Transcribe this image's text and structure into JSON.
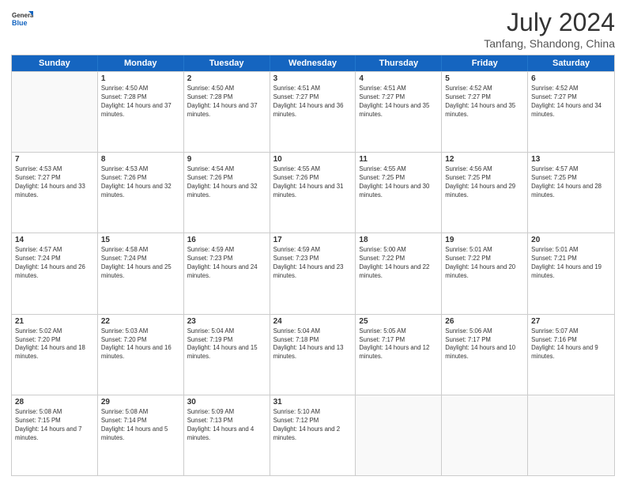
{
  "header": {
    "logo": {
      "general": "General",
      "blue": "Blue"
    },
    "title": "July 2024",
    "location": "Tanfang, Shandong, China"
  },
  "days_of_week": [
    "Sunday",
    "Monday",
    "Tuesday",
    "Wednesday",
    "Thursday",
    "Friday",
    "Saturday"
  ],
  "weeks": [
    [
      {
        "day": "",
        "empty": true
      },
      {
        "day": "1",
        "sunrise": "Sunrise: 4:50 AM",
        "sunset": "Sunset: 7:28 PM",
        "daylight": "Daylight: 14 hours and 37 minutes."
      },
      {
        "day": "2",
        "sunrise": "Sunrise: 4:50 AM",
        "sunset": "Sunset: 7:28 PM",
        "daylight": "Daylight: 14 hours and 37 minutes."
      },
      {
        "day": "3",
        "sunrise": "Sunrise: 4:51 AM",
        "sunset": "Sunset: 7:27 PM",
        "daylight": "Daylight: 14 hours and 36 minutes."
      },
      {
        "day": "4",
        "sunrise": "Sunrise: 4:51 AM",
        "sunset": "Sunset: 7:27 PM",
        "daylight": "Daylight: 14 hours and 35 minutes."
      },
      {
        "day": "5",
        "sunrise": "Sunrise: 4:52 AM",
        "sunset": "Sunset: 7:27 PM",
        "daylight": "Daylight: 14 hours and 35 minutes."
      },
      {
        "day": "6",
        "sunrise": "Sunrise: 4:52 AM",
        "sunset": "Sunset: 7:27 PM",
        "daylight": "Daylight: 14 hours and 34 minutes."
      }
    ],
    [
      {
        "day": "7",
        "sunrise": "Sunrise: 4:53 AM",
        "sunset": "Sunset: 7:27 PM",
        "daylight": "Daylight: 14 hours and 33 minutes."
      },
      {
        "day": "8",
        "sunrise": "Sunrise: 4:53 AM",
        "sunset": "Sunset: 7:26 PM",
        "daylight": "Daylight: 14 hours and 32 minutes."
      },
      {
        "day": "9",
        "sunrise": "Sunrise: 4:54 AM",
        "sunset": "Sunset: 7:26 PM",
        "daylight": "Daylight: 14 hours and 32 minutes."
      },
      {
        "day": "10",
        "sunrise": "Sunrise: 4:55 AM",
        "sunset": "Sunset: 7:26 PM",
        "daylight": "Daylight: 14 hours and 31 minutes."
      },
      {
        "day": "11",
        "sunrise": "Sunrise: 4:55 AM",
        "sunset": "Sunset: 7:25 PM",
        "daylight": "Daylight: 14 hours and 30 minutes."
      },
      {
        "day": "12",
        "sunrise": "Sunrise: 4:56 AM",
        "sunset": "Sunset: 7:25 PM",
        "daylight": "Daylight: 14 hours and 29 minutes."
      },
      {
        "day": "13",
        "sunrise": "Sunrise: 4:57 AM",
        "sunset": "Sunset: 7:25 PM",
        "daylight": "Daylight: 14 hours and 28 minutes."
      }
    ],
    [
      {
        "day": "14",
        "sunrise": "Sunrise: 4:57 AM",
        "sunset": "Sunset: 7:24 PM",
        "daylight": "Daylight: 14 hours and 26 minutes."
      },
      {
        "day": "15",
        "sunrise": "Sunrise: 4:58 AM",
        "sunset": "Sunset: 7:24 PM",
        "daylight": "Daylight: 14 hours and 25 minutes."
      },
      {
        "day": "16",
        "sunrise": "Sunrise: 4:59 AM",
        "sunset": "Sunset: 7:23 PM",
        "daylight": "Daylight: 14 hours and 24 minutes."
      },
      {
        "day": "17",
        "sunrise": "Sunrise: 4:59 AM",
        "sunset": "Sunset: 7:23 PM",
        "daylight": "Daylight: 14 hours and 23 minutes."
      },
      {
        "day": "18",
        "sunrise": "Sunrise: 5:00 AM",
        "sunset": "Sunset: 7:22 PM",
        "daylight": "Daylight: 14 hours and 22 minutes."
      },
      {
        "day": "19",
        "sunrise": "Sunrise: 5:01 AM",
        "sunset": "Sunset: 7:22 PM",
        "daylight": "Daylight: 14 hours and 20 minutes."
      },
      {
        "day": "20",
        "sunrise": "Sunrise: 5:01 AM",
        "sunset": "Sunset: 7:21 PM",
        "daylight": "Daylight: 14 hours and 19 minutes."
      }
    ],
    [
      {
        "day": "21",
        "sunrise": "Sunrise: 5:02 AM",
        "sunset": "Sunset: 7:20 PM",
        "daylight": "Daylight: 14 hours and 18 minutes."
      },
      {
        "day": "22",
        "sunrise": "Sunrise: 5:03 AM",
        "sunset": "Sunset: 7:20 PM",
        "daylight": "Daylight: 14 hours and 16 minutes."
      },
      {
        "day": "23",
        "sunrise": "Sunrise: 5:04 AM",
        "sunset": "Sunset: 7:19 PM",
        "daylight": "Daylight: 14 hours and 15 minutes."
      },
      {
        "day": "24",
        "sunrise": "Sunrise: 5:04 AM",
        "sunset": "Sunset: 7:18 PM",
        "daylight": "Daylight: 14 hours and 13 minutes."
      },
      {
        "day": "25",
        "sunrise": "Sunrise: 5:05 AM",
        "sunset": "Sunset: 7:17 PM",
        "daylight": "Daylight: 14 hours and 12 minutes."
      },
      {
        "day": "26",
        "sunrise": "Sunrise: 5:06 AM",
        "sunset": "Sunset: 7:17 PM",
        "daylight": "Daylight: 14 hours and 10 minutes."
      },
      {
        "day": "27",
        "sunrise": "Sunrise: 5:07 AM",
        "sunset": "Sunset: 7:16 PM",
        "daylight": "Daylight: 14 hours and 9 minutes."
      }
    ],
    [
      {
        "day": "28",
        "sunrise": "Sunrise: 5:08 AM",
        "sunset": "Sunset: 7:15 PM",
        "daylight": "Daylight: 14 hours and 7 minutes."
      },
      {
        "day": "29",
        "sunrise": "Sunrise: 5:08 AM",
        "sunset": "Sunset: 7:14 PM",
        "daylight": "Daylight: 14 hours and 5 minutes."
      },
      {
        "day": "30",
        "sunrise": "Sunrise: 5:09 AM",
        "sunset": "Sunset: 7:13 PM",
        "daylight": "Daylight: 14 hours and 4 minutes."
      },
      {
        "day": "31",
        "sunrise": "Sunrise: 5:10 AM",
        "sunset": "Sunset: 7:12 PM",
        "daylight": "Daylight: 14 hours and 2 minutes."
      },
      {
        "day": "",
        "empty": true
      },
      {
        "day": "",
        "empty": true
      },
      {
        "day": "",
        "empty": true
      }
    ]
  ]
}
